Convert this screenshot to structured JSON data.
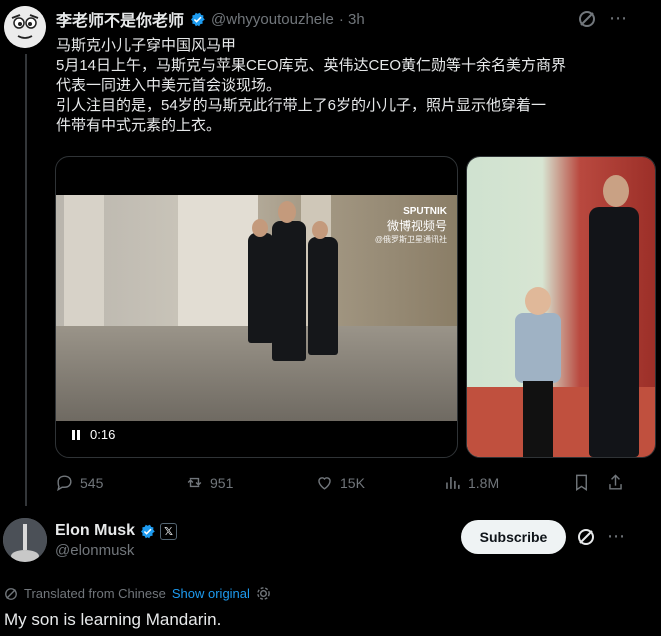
{
  "tweet1": {
    "display_name": "李老师不是你老师",
    "handle": "@whyyoutouzhele",
    "time": "· 3h",
    "lines": [
      "马斯克小儿子穿中国风马甲",
      "5月14日上午，马斯克与苹果CEO库克、英伟达CEO黄仁勋等十余名美方商界",
      "代表一同进入中美元首会谈现场。",
      "引人注目的是，54岁的马斯克此行带上了6岁的小儿子，照片显示他穿着一",
      "件带有中式元素的上衣。"
    ],
    "video": {
      "time": "0:16",
      "watermark_brand": "SPUTNIK",
      "watermark_weibo": "微博视频号",
      "watermark_sub": "@俄罗斯卫星通讯社"
    },
    "stats": {
      "replies": "545",
      "reposts": "951",
      "likes": "15K",
      "views": "1.8M"
    }
  },
  "tweet2": {
    "display_name": "Elon Musk",
    "handle": "@elonmusk",
    "subscribe_label": "Subscribe",
    "translated_label": "Translated from Chinese",
    "show_original_label": "Show original",
    "text": "My son is learning Mandarin."
  },
  "colors": {
    "background": "#000000",
    "text": "#e7e9ea",
    "muted": "#71767b",
    "accent": "#1d9bf0",
    "divider": "#2f3336"
  },
  "icons": [
    "verified-icon",
    "grok-icon",
    "more-icon",
    "reply-icon",
    "repost-icon",
    "like-icon",
    "views-icon",
    "bookmark-icon",
    "share-icon",
    "pause-icon",
    "x-badge-icon",
    "settings-icon"
  ]
}
